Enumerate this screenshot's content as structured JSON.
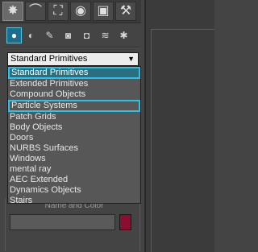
{
  "command_panel": {
    "tabs": [
      {
        "name": "Create",
        "icon": "sun-star-icon",
        "glyph": "✸",
        "active": true
      },
      {
        "name": "Modify",
        "icon": "curve-icon",
        "glyph": "⌒",
        "active": false
      },
      {
        "name": "Hierarchy",
        "icon": "hierarchy-icon",
        "glyph": "⛶",
        "active": false
      },
      {
        "name": "Motion",
        "icon": "motion-icon",
        "glyph": "◉",
        "active": false
      },
      {
        "name": "Display",
        "icon": "display-monitor-icon",
        "glyph": "▣",
        "active": false
      },
      {
        "name": "Utilities",
        "icon": "hammer-icon",
        "glyph": "⚒",
        "active": false
      }
    ],
    "categories": [
      {
        "name": "Geometry",
        "icon": "geometry-sphere-icon",
        "glyph": "●",
        "active": true
      },
      {
        "name": "Shapes",
        "icon": "shapes-icon",
        "glyph": "◐",
        "active": false
      },
      {
        "name": "Lights",
        "icon": "light-icon",
        "glyph": "✎",
        "active": false
      },
      {
        "name": "Cameras",
        "icon": "camera-icon",
        "glyph": "◙",
        "active": false
      },
      {
        "name": "Helpers",
        "icon": "helper-tape-icon",
        "glyph": "◘",
        "active": false
      },
      {
        "name": "Space Warps",
        "icon": "space-warp-icon",
        "glyph": "≋",
        "active": false
      },
      {
        "name": "Systems",
        "icon": "systems-icon",
        "glyph": "✱",
        "active": false
      }
    ]
  },
  "dropdown": {
    "selected": "Standard Primitives",
    "arrow": "▼",
    "options": [
      {
        "label": "Standard Primitives",
        "state": "selected"
      },
      {
        "label": "Extended Primitives",
        "state": ""
      },
      {
        "label": "Compound Objects",
        "state": ""
      },
      {
        "label": "Particle Systems",
        "state": "hovered"
      },
      {
        "label": "Patch Grids",
        "state": ""
      },
      {
        "label": "Body Objects",
        "state": ""
      },
      {
        "label": "Doors",
        "state": ""
      },
      {
        "label": "NURBS Surfaces",
        "state": ""
      },
      {
        "label": "Windows",
        "state": ""
      },
      {
        "label": "mental ray",
        "state": ""
      },
      {
        "label": "AEC Extended",
        "state": ""
      },
      {
        "label": "Dynamics Objects",
        "state": ""
      },
      {
        "label": "Stairs",
        "state": ""
      }
    ]
  },
  "rollout": {
    "title": "Name and Color",
    "swatch_color": "#8b0e2e"
  },
  "colors": {
    "accent": "#29c3e8",
    "panel": "#444444"
  }
}
